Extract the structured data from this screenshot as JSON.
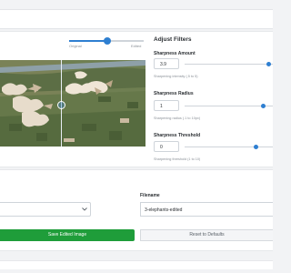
{
  "compare": {
    "original_label": "Original",
    "edited_label": "Edited",
    "position_fraction": 0.54
  },
  "filters": {
    "title": "Adjust Filters",
    "items": [
      {
        "label": "Sharpness Amount",
        "value": "3.9",
        "hint": "Sharpening intensity (.5 to 5)",
        "level": 1.0
      },
      {
        "label": "Sharpness Radius",
        "value": "1",
        "hint": "Sharpening radius (.1 to 10px)",
        "level": 0.94
      },
      {
        "label": "Sharpness Threshold",
        "value": "0",
        "hint": "Sharpening threshold (1 to 10)",
        "level": 0.85
      }
    ]
  },
  "export": {
    "filename_label": "Filename",
    "filename_value": "3-elephants-edited",
    "save_label": "Save Edited Image",
    "reset_label": "Reset to Defaults"
  },
  "icons": {
    "select": "chevron-down-icon"
  },
  "colors": {
    "accent": "#2e7fd1",
    "save": "#1f9d3a"
  }
}
